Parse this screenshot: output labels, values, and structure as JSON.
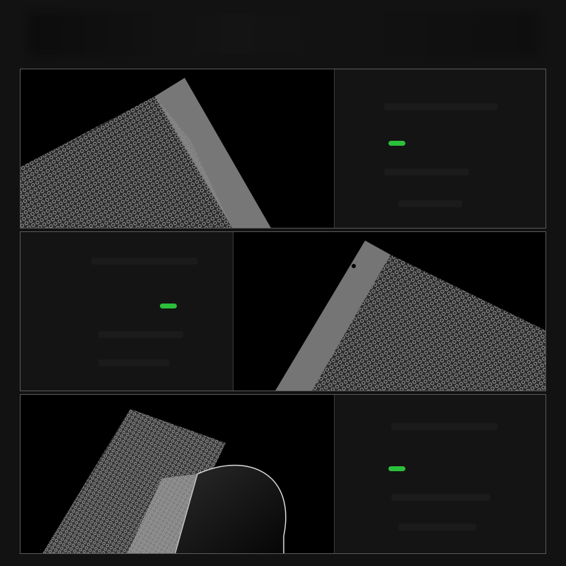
{
  "panels": [
    {
      "photo": "vacuum-bag-embossed-texture-corner-left",
      "accent": "#2bbf3b"
    },
    {
      "photo": "vacuum-bag-tear-notch-corner-right",
      "accent": "#2bbf3b"
    },
    {
      "photo": "vacuum-bag-open-mouth-smooth-and-embossed-sides",
      "accent": "#2bbf3b"
    }
  ],
  "colors": {
    "background": "#121212",
    "panel_border": "#5a5a5a",
    "accent_green": "#2bbf3b"
  }
}
